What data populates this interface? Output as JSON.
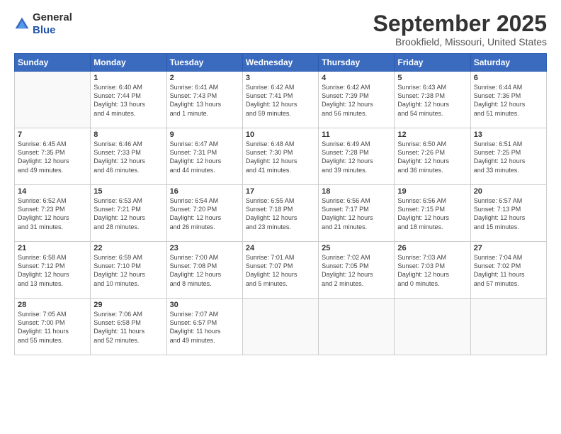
{
  "logo": {
    "general": "General",
    "blue": "Blue"
  },
  "header": {
    "title": "September 2025",
    "subtitle": "Brookfield, Missouri, United States"
  },
  "weekdays": [
    "Sunday",
    "Monday",
    "Tuesday",
    "Wednesday",
    "Thursday",
    "Friday",
    "Saturday"
  ],
  "weeks": [
    [
      {
        "day": "",
        "info": ""
      },
      {
        "day": "1",
        "info": "Sunrise: 6:40 AM\nSunset: 7:44 PM\nDaylight: 13 hours\nand 4 minutes."
      },
      {
        "day": "2",
        "info": "Sunrise: 6:41 AM\nSunset: 7:43 PM\nDaylight: 13 hours\nand 1 minute."
      },
      {
        "day": "3",
        "info": "Sunrise: 6:42 AM\nSunset: 7:41 PM\nDaylight: 12 hours\nand 59 minutes."
      },
      {
        "day": "4",
        "info": "Sunrise: 6:42 AM\nSunset: 7:39 PM\nDaylight: 12 hours\nand 56 minutes."
      },
      {
        "day": "5",
        "info": "Sunrise: 6:43 AM\nSunset: 7:38 PM\nDaylight: 12 hours\nand 54 minutes."
      },
      {
        "day": "6",
        "info": "Sunrise: 6:44 AM\nSunset: 7:36 PM\nDaylight: 12 hours\nand 51 minutes."
      }
    ],
    [
      {
        "day": "7",
        "info": "Sunrise: 6:45 AM\nSunset: 7:35 PM\nDaylight: 12 hours\nand 49 minutes."
      },
      {
        "day": "8",
        "info": "Sunrise: 6:46 AM\nSunset: 7:33 PM\nDaylight: 12 hours\nand 46 minutes."
      },
      {
        "day": "9",
        "info": "Sunrise: 6:47 AM\nSunset: 7:31 PM\nDaylight: 12 hours\nand 44 minutes."
      },
      {
        "day": "10",
        "info": "Sunrise: 6:48 AM\nSunset: 7:30 PM\nDaylight: 12 hours\nand 41 minutes."
      },
      {
        "day": "11",
        "info": "Sunrise: 6:49 AM\nSunset: 7:28 PM\nDaylight: 12 hours\nand 39 minutes."
      },
      {
        "day": "12",
        "info": "Sunrise: 6:50 AM\nSunset: 7:26 PM\nDaylight: 12 hours\nand 36 minutes."
      },
      {
        "day": "13",
        "info": "Sunrise: 6:51 AM\nSunset: 7:25 PM\nDaylight: 12 hours\nand 33 minutes."
      }
    ],
    [
      {
        "day": "14",
        "info": "Sunrise: 6:52 AM\nSunset: 7:23 PM\nDaylight: 12 hours\nand 31 minutes."
      },
      {
        "day": "15",
        "info": "Sunrise: 6:53 AM\nSunset: 7:21 PM\nDaylight: 12 hours\nand 28 minutes."
      },
      {
        "day": "16",
        "info": "Sunrise: 6:54 AM\nSunset: 7:20 PM\nDaylight: 12 hours\nand 26 minutes."
      },
      {
        "day": "17",
        "info": "Sunrise: 6:55 AM\nSunset: 7:18 PM\nDaylight: 12 hours\nand 23 minutes."
      },
      {
        "day": "18",
        "info": "Sunrise: 6:56 AM\nSunset: 7:17 PM\nDaylight: 12 hours\nand 21 minutes."
      },
      {
        "day": "19",
        "info": "Sunrise: 6:56 AM\nSunset: 7:15 PM\nDaylight: 12 hours\nand 18 minutes."
      },
      {
        "day": "20",
        "info": "Sunrise: 6:57 AM\nSunset: 7:13 PM\nDaylight: 12 hours\nand 15 minutes."
      }
    ],
    [
      {
        "day": "21",
        "info": "Sunrise: 6:58 AM\nSunset: 7:12 PM\nDaylight: 12 hours\nand 13 minutes."
      },
      {
        "day": "22",
        "info": "Sunrise: 6:59 AM\nSunset: 7:10 PM\nDaylight: 12 hours\nand 10 minutes."
      },
      {
        "day": "23",
        "info": "Sunrise: 7:00 AM\nSunset: 7:08 PM\nDaylight: 12 hours\nand 8 minutes."
      },
      {
        "day": "24",
        "info": "Sunrise: 7:01 AM\nSunset: 7:07 PM\nDaylight: 12 hours\nand 5 minutes."
      },
      {
        "day": "25",
        "info": "Sunrise: 7:02 AM\nSunset: 7:05 PM\nDaylight: 12 hours\nand 2 minutes."
      },
      {
        "day": "26",
        "info": "Sunrise: 7:03 AM\nSunset: 7:03 PM\nDaylight: 12 hours\nand 0 minutes."
      },
      {
        "day": "27",
        "info": "Sunrise: 7:04 AM\nSunset: 7:02 PM\nDaylight: 11 hours\nand 57 minutes."
      }
    ],
    [
      {
        "day": "28",
        "info": "Sunrise: 7:05 AM\nSunset: 7:00 PM\nDaylight: 11 hours\nand 55 minutes."
      },
      {
        "day": "29",
        "info": "Sunrise: 7:06 AM\nSunset: 6:58 PM\nDaylight: 11 hours\nand 52 minutes."
      },
      {
        "day": "30",
        "info": "Sunrise: 7:07 AM\nSunset: 6:57 PM\nDaylight: 11 hours\nand 49 minutes."
      },
      {
        "day": "",
        "info": ""
      },
      {
        "day": "",
        "info": ""
      },
      {
        "day": "",
        "info": ""
      },
      {
        "day": "",
        "info": ""
      }
    ]
  ]
}
